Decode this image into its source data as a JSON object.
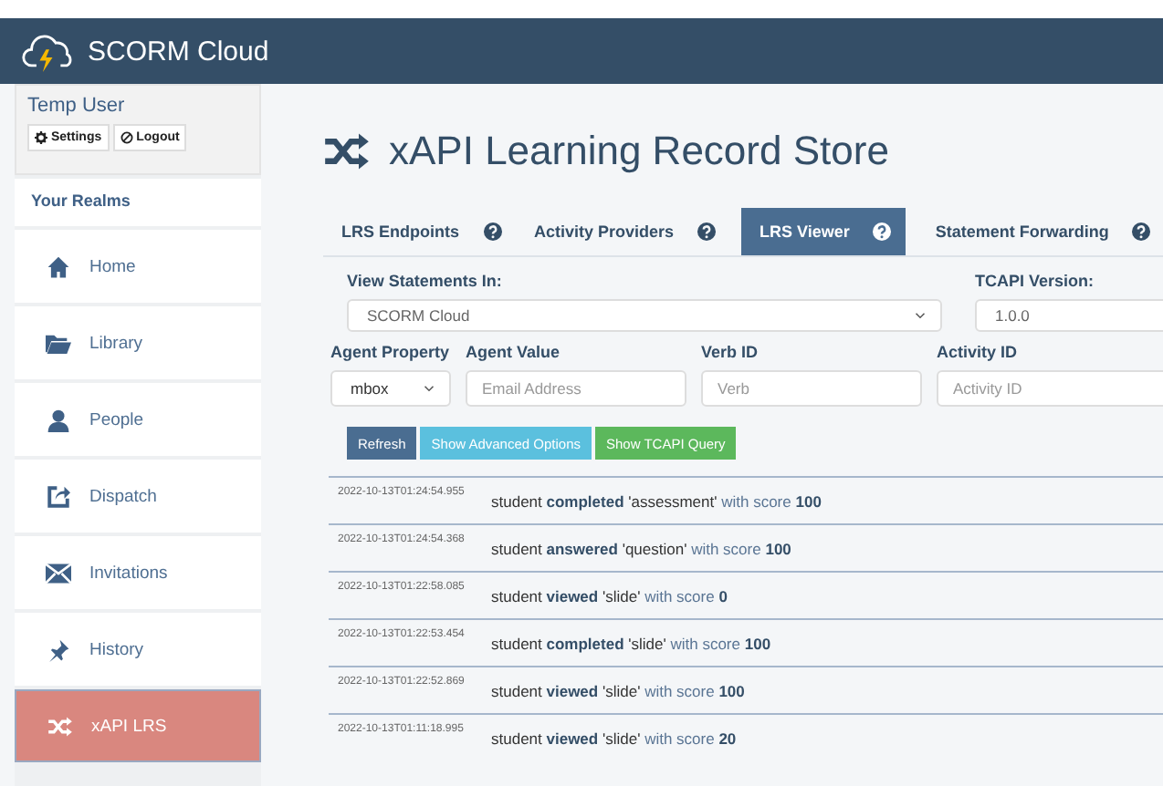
{
  "brand": {
    "name": "SCORM Cloud"
  },
  "user": {
    "name": "Temp User",
    "buttons": [
      {
        "kind": "settings",
        "label": "Settings"
      },
      {
        "kind": "logout",
        "label": "Logout"
      }
    ]
  },
  "sidebar": {
    "heading": "Your Realms",
    "items": [
      {
        "kind": "home",
        "label": "Home",
        "selected": false
      },
      {
        "kind": "library",
        "label": "Library",
        "selected": false
      },
      {
        "kind": "people",
        "label": "People",
        "selected": false
      },
      {
        "kind": "dispatch",
        "label": "Dispatch",
        "selected": false
      },
      {
        "kind": "invitations",
        "label": "Invitations",
        "selected": false
      },
      {
        "kind": "history",
        "label": "History",
        "selected": false
      },
      {
        "kind": "xapi",
        "label": "xAPI LRS",
        "selected": true
      }
    ]
  },
  "page_title": "xAPI Learning Record Store",
  "tabs": [
    {
      "label": "LRS Endpoints",
      "selected": false
    },
    {
      "label": "Activity Providers",
      "selected": false
    },
    {
      "label": "LRS Viewer",
      "selected": true
    },
    {
      "label": "Statement Forwarding",
      "selected": false
    }
  ],
  "filters": {
    "view_in": {
      "label": "View Statements In:",
      "value": "SCORM Cloud"
    },
    "tcapi_version": {
      "label": "TCAPI Version:",
      "value": "1.0.0"
    },
    "agent_property": {
      "label": "Agent Property",
      "value": "mbox"
    },
    "agent_value": {
      "label": "Agent Value",
      "placeholder": "Email Address"
    },
    "verb_id": {
      "label": "Verb ID",
      "placeholder": "Verb"
    },
    "activity_id": {
      "label": "Activity ID",
      "placeholder": "Activity ID"
    }
  },
  "buttons": [
    {
      "kind": "primary",
      "label": "Refresh"
    },
    {
      "kind": "info",
      "label": "Show Advanced Options"
    },
    {
      "kind": "success",
      "label": "Show TCAPI Query"
    }
  ],
  "statements": [
    {
      "timestamp": "2022-10-13T01:24:54.955",
      "actor": "student",
      "verb": "completed",
      "object": "'assessment'",
      "with": "with score",
      "score": "100"
    },
    {
      "timestamp": "2022-10-13T01:24:54.368",
      "actor": "student",
      "verb": "answered",
      "object": "'question'",
      "with": "with score",
      "score": "100"
    },
    {
      "timestamp": "2022-10-13T01:22:58.085",
      "actor": "student",
      "verb": "viewed",
      "object": "'slide'",
      "with": "with score",
      "score": "0"
    },
    {
      "timestamp": "2022-10-13T01:22:53.454",
      "actor": "student",
      "verb": "completed",
      "object": "'slide'",
      "with": "with score",
      "score": "100"
    },
    {
      "timestamp": "2022-10-13T01:22:52.869",
      "actor": "student",
      "verb": "viewed",
      "object": "'slide'",
      "with": "with score",
      "score": "100"
    },
    {
      "timestamp": "2022-10-13T01:11:18.995",
      "actor": "student",
      "verb": "viewed",
      "object": "'slide'",
      "with": "with score",
      "score": "20"
    }
  ]
}
